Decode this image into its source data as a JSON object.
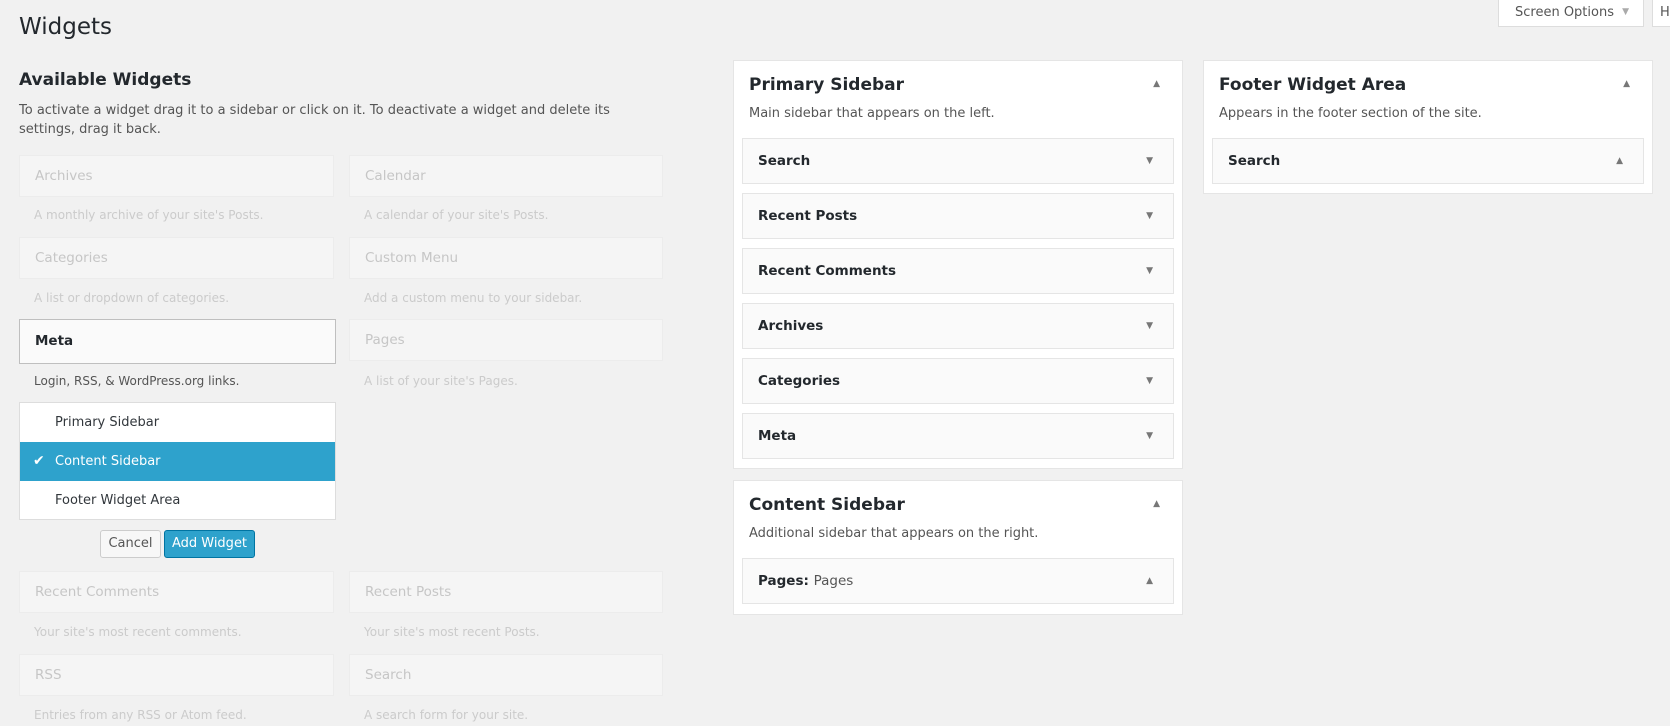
{
  "header": {
    "page_title": "Widgets",
    "screen_options_label": "Screen Options",
    "help_label": "H"
  },
  "available": {
    "title": "Available Widgets",
    "description": "To activate a widget drag it to a sidebar or click on it. To deactivate a widget and delete its settings, drag it back.",
    "widgets": [
      {
        "title": "Archives",
        "desc": "A monthly archive of your site's Posts."
      },
      {
        "title": "Calendar",
        "desc": "A calendar of your site's Posts."
      },
      {
        "title": "Categories",
        "desc": "A list or dropdown of categories."
      },
      {
        "title": "Custom Menu",
        "desc": "Add a custom menu to your sidebar."
      },
      {
        "title": "Meta",
        "desc": "Login, RSS, & WordPress.org links."
      },
      {
        "title": "Pages",
        "desc": "A list of your site's Pages."
      },
      {
        "title": "Recent Comments",
        "desc": "Your site's most recent comments."
      },
      {
        "title": "Recent Posts",
        "desc": "Your site's most recent Posts."
      },
      {
        "title": "RSS",
        "desc": "Entries from any RSS or Atom feed."
      },
      {
        "title": "Search",
        "desc": "A search form for your site."
      }
    ],
    "chooser": {
      "options": [
        "Primary Sidebar",
        "Content Sidebar",
        "Footer Widget Area"
      ],
      "selected": "Content Sidebar",
      "check_glyph": "✔"
    },
    "cancel_label": "Cancel",
    "add_label": "Add Widget"
  },
  "sidebars": {
    "primary": {
      "title": "Primary Sidebar",
      "description": "Main sidebar that appears on the left.",
      "widgets": [
        "Search",
        "Recent Posts",
        "Recent Comments",
        "Archives",
        "Categories",
        "Meta"
      ]
    },
    "content": {
      "title": "Content Sidebar",
      "description": "Additional sidebar that appears on the right.",
      "widget_label": "Pages:",
      "widget_sub": "Pages"
    },
    "footer": {
      "title": "Footer Widget Area",
      "description": "Appears in the footer section of the site.",
      "widgets": [
        "Search"
      ]
    }
  },
  "icons": {
    "arrow_down": "▼",
    "arrow_up": "▲"
  },
  "colors": {
    "accent": "#2ea2cc",
    "background": "#f1f1f1"
  }
}
